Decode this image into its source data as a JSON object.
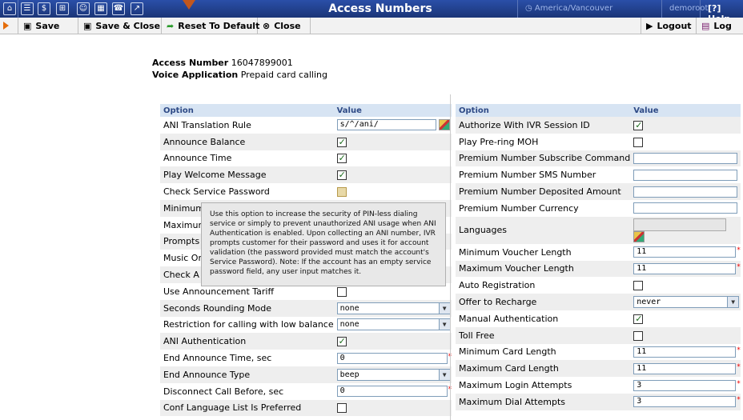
{
  "app": {
    "title": "Access Numbers",
    "timezone": "America/Vancouver",
    "user": "demoroot",
    "help_label": "Help"
  },
  "topbar_icons": [
    "home-icon",
    "list-icon",
    "dollar-icon",
    "grid-icon",
    "person-icon",
    "chart-icon",
    "phone-icon",
    "graph-icon"
  ],
  "toolbar": {
    "save": "Save",
    "save_close": "Save & Close",
    "reset": "Reset To Default",
    "close": "Close",
    "logout": "Logout",
    "log": "Log"
  },
  "header": {
    "access_number_label": "Access Number",
    "access_number_value": "16047899001",
    "voice_app_label": "Voice Application",
    "voice_app_value": "Prepaid card calling"
  },
  "left_table": {
    "col_option": "Option",
    "col_value": "Value",
    "rows": [
      {
        "label": "ANI Translation Rule",
        "value": "s/^/ani/"
      },
      {
        "label": "Announce Balance",
        "checked": true
      },
      {
        "label": "Announce Time",
        "checked": true
      },
      {
        "label": "Play Welcome Message",
        "checked": true
      },
      {
        "label": "Check Service Password",
        "checked": false
      },
      {
        "label": "Minimum"
      },
      {
        "label": "Maximum"
      },
      {
        "label": "Prompts"
      },
      {
        "label": "Music On"
      },
      {
        "label": "Check A"
      },
      {
        "label": "Use Announcement Tariff"
      },
      {
        "label": "Seconds Rounding Mode",
        "value": "none"
      },
      {
        "label": "Restriction for calling with low balance",
        "value": "none"
      },
      {
        "label": "ANI Authentication",
        "checked": true
      },
      {
        "label": "End Announce Time, sec",
        "value": "0"
      },
      {
        "label": "End Announce Type",
        "value": "beep"
      },
      {
        "label": "Disconnect Call Before, sec",
        "value": "0"
      },
      {
        "label": "Conf Language List Is Preferred",
        "checked": false
      }
    ]
  },
  "right_table": {
    "col_option": "Option",
    "col_value": "Value",
    "rows": [
      {
        "label": "Authorize With IVR Session ID",
        "checked": true
      },
      {
        "label": "Play Pre-ring MOH",
        "checked": false
      },
      {
        "label": "Premium Number Subscribe Command",
        "value": ""
      },
      {
        "label": "Premium Number SMS Number",
        "value": ""
      },
      {
        "label": "Premium Number Deposited Amount",
        "value": ""
      },
      {
        "label": "Premium Number Currency",
        "value": ""
      },
      {
        "label": "Languages",
        "value": ""
      },
      {
        "label": "Minimum Voucher Length",
        "value": "11"
      },
      {
        "label": "Maximum Voucher Length",
        "value": "11"
      },
      {
        "label": "Auto Registration",
        "checked": false
      },
      {
        "label": "Offer to Recharge",
        "value": "never"
      },
      {
        "label": "Manual Authentication",
        "checked": true
      },
      {
        "label": "Toll Free",
        "checked": false
      },
      {
        "label": "Minimum Card Length",
        "value": "11"
      },
      {
        "label": "Maximum Card Length",
        "value": "11"
      },
      {
        "label": "Maximum Login Attempts",
        "value": "3"
      },
      {
        "label": "Maximum Dial Attempts",
        "value": "3"
      }
    ]
  },
  "tooltip": {
    "text": "Use this option to increase the security of PIN-less dialing service or simply to prevent unauthorized ANI usage when ANI Authentication is enabled. Upon collecting an ANI number, IVR prompts customer for their password and uses it for account validation (the password provided must match the account's Service Password). Note: If the account has an empty service password field, any user input matches it."
  }
}
